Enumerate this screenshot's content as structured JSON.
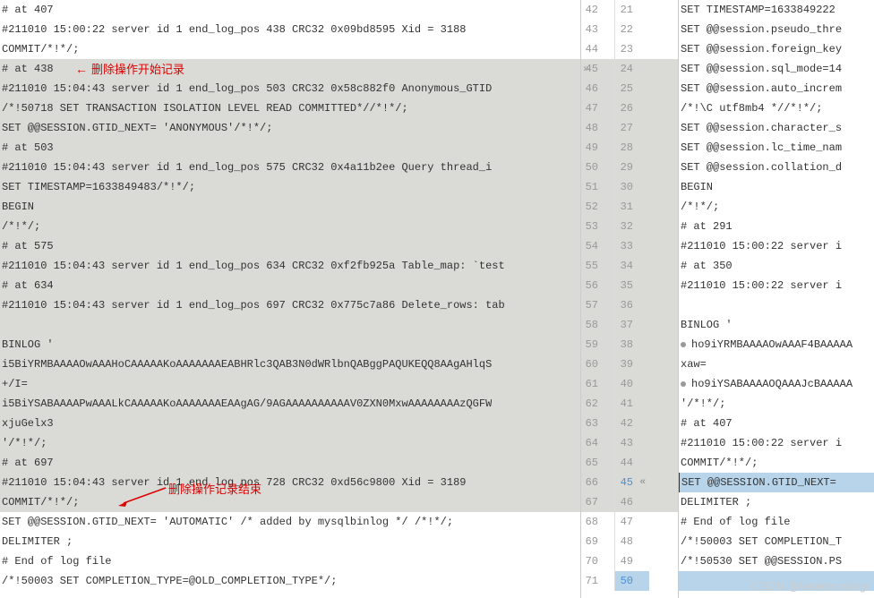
{
  "left_lines": [
    {
      "text": "# at 407",
      "hl": false
    },
    {
      "text": "#211010 15:00:22 server id 1  end_log_pos 438 CRC32 0x09bd8595  Xid = 3188",
      "hl": false
    },
    {
      "text": "COMMIT/*!*/;",
      "hl": false
    },
    {
      "text": "# at 438",
      "hl": true
    },
    {
      "text": "#211010 15:04:43 server id 1  end_log_pos 503 CRC32 0x58c882f0  Anonymous_GTID",
      "hl": true
    },
    {
      "text": "/*!50718 SET TRANSACTION ISOLATION LEVEL READ COMMITTED*//*!*/;",
      "hl": true
    },
    {
      "text": "SET @@SESSION.GTID_NEXT= 'ANONYMOUS'/*!*/;",
      "hl": true
    },
    {
      "text": "# at 503",
      "hl": true
    },
    {
      "text": "#211010 15:04:43 server id 1  end_log_pos 575 CRC32 0x4a11b2ee  Query   thread_i",
      "hl": true
    },
    {
      "text": "SET TIMESTAMP=1633849483/*!*/;",
      "hl": true
    },
    {
      "text": "BEGIN",
      "hl": true
    },
    {
      "text": "/*!*/;",
      "hl": true
    },
    {
      "text": "# at 575",
      "hl": true
    },
    {
      "text": "#211010 15:04:43 server id 1  end_log_pos 634 CRC32 0xf2fb925a  Table_map: `test",
      "hl": true
    },
    {
      "text": "# at 634",
      "hl": true
    },
    {
      "text": "#211010 15:04:43 server id 1  end_log_pos 697 CRC32 0x775c7a86  Delete_rows: tab",
      "hl": true
    },
    {
      "text": "",
      "hl": true
    },
    {
      "text": "BINLOG '",
      "hl": true
    },
    {
      "text": "i5BiYRMBAAAAOwAAAHoCAAAAAKoAAAAAAAEABHRlc3QAB3N0dWRlbnQABggPAQUKEQQ8AAgAHlqS",
      "hl": true
    },
    {
      "text": "+/I=",
      "hl": true
    },
    {
      "text": "i5BiYSABAAAAPwAAALkCAAAAAKoAAAAAAAEAAgAG/9AGAAAAAAAAAAV0ZXN0MxwAAAAAAAAzQGFW",
      "hl": true
    },
    {
      "text": "xjuGelx3",
      "hl": true
    },
    {
      "text": "'/*!*/;",
      "hl": true
    },
    {
      "text": "# at 697",
      "hl": true
    },
    {
      "text": "#211010 15:04:43 server id 1  end_log_pos 728 CRC32 0xd56c9800  Xid = 3189",
      "hl": true
    },
    {
      "text": "COMMIT/*!*/;",
      "hl": true
    },
    {
      "text": "SET @@SESSION.GTID_NEXT= 'AUTOMATIC' /* added by mysqlbinlog */ /*!*/;",
      "hl": false
    },
    {
      "text": "DELIMITER ;",
      "hl": false
    },
    {
      "text": "# End of log file",
      "hl": false
    },
    {
      "text": "/*!50003 SET COMPLETION_TYPE=@OLD_COMPLETION_TYPE*/;",
      "hl": false
    }
  ],
  "gutters": [
    {
      "l": "42",
      "r": "21"
    },
    {
      "l": "43",
      "r": "22"
    },
    {
      "l": "44",
      "r": "23"
    },
    {
      "l": "45",
      "r": "24",
      "hl": "left",
      "diff_marker": "»"
    },
    {
      "l": "46",
      "r": "25",
      "hl": "left"
    },
    {
      "l": "47",
      "r": "26",
      "hl": "left"
    },
    {
      "l": "48",
      "r": "27",
      "hl": "left"
    },
    {
      "l": "49",
      "r": "28",
      "hl": "left"
    },
    {
      "l": "50",
      "r": "29",
      "hl": "left"
    },
    {
      "l": "51",
      "r": "30",
      "hl": "left"
    },
    {
      "l": "52",
      "r": "31",
      "hl": "left"
    },
    {
      "l": "53",
      "r": "32",
      "hl": "left"
    },
    {
      "l": "54",
      "r": "33",
      "hl": "left"
    },
    {
      "l": "55",
      "r": "34",
      "hl": "left"
    },
    {
      "l": "56",
      "r": "35",
      "hl": "left"
    },
    {
      "l": "57",
      "r": "36",
      "hl": "left"
    },
    {
      "l": "58",
      "r": "37",
      "hl": "left"
    },
    {
      "l": "59",
      "r": "38",
      "hl": "left"
    },
    {
      "l": "60",
      "r": "39",
      "hl": "left"
    },
    {
      "l": "61",
      "r": "40",
      "hl": "left"
    },
    {
      "l": "62",
      "r": "41",
      "hl": "left"
    },
    {
      "l": "63",
      "r": "42",
      "hl": "left"
    },
    {
      "l": "64",
      "r": "43",
      "hl": "left"
    },
    {
      "l": "65",
      "r": "44",
      "hl": "left"
    },
    {
      "l": "66",
      "r": "45",
      "hl": "left",
      "diff_marker": "«",
      "blue": true
    },
    {
      "l": "67",
      "r": "46",
      "hl": "left"
    },
    {
      "l": "68",
      "r": "47"
    },
    {
      "l": "69",
      "r": "48"
    },
    {
      "l": "70",
      "r": "49"
    },
    {
      "l": "71",
      "r": "50",
      "hl": "right",
      "blue": true
    }
  ],
  "right_lines": [
    {
      "text": "SET TIMESTAMP=1633849222",
      "hl": false
    },
    {
      "text": "SET @@session.pseudo_thre",
      "hl": false
    },
    {
      "text": "SET @@session.foreign_key",
      "hl": false
    },
    {
      "text": "SET @@session.sql_mode=14",
      "hl": false
    },
    {
      "text": "SET @@session.auto_increm",
      "hl": false
    },
    {
      "text": "/*!\\C utf8mb4 *//*!*/;",
      "hl": false
    },
    {
      "text": "SET @@session.character_s",
      "hl": false
    },
    {
      "text": "SET @@session.lc_time_nam",
      "hl": false
    },
    {
      "text": "SET @@session.collation_d",
      "hl": false
    },
    {
      "text": "BEGIN",
      "hl": false
    },
    {
      "text": "/*!*/;",
      "hl": false
    },
    {
      "text": "# at 291",
      "hl": false
    },
    {
      "text": "#211010 15:00:22 server i",
      "hl": false
    },
    {
      "text": "# at 350",
      "hl": false
    },
    {
      "text": "#211010 15:00:22 server i",
      "hl": false
    },
    {
      "text": "",
      "hl": false
    },
    {
      "text": "BINLOG '",
      "hl": false
    },
    {
      "text": "ho9iYRMBAAAAOwAAAF4BAAAAA",
      "hl": false,
      "dot": true
    },
    {
      "text": "xaw=",
      "hl": false
    },
    {
      "text": "ho9iYSABAAAAOQAAAJcBAAAAA",
      "hl": false,
      "dot": true
    },
    {
      "text": "'/*!*/;",
      "hl": false
    },
    {
      "text": "# at 407",
      "hl": false
    },
    {
      "text": "#211010 15:00:22 server i",
      "hl": false
    },
    {
      "text": "COMMIT/*!*/;",
      "hl": false
    },
    {
      "text": "SET @@SESSION.GTID_NEXT=",
      "hl": "blue",
      "cursor": true
    },
    {
      "text": "DELIMITER ;",
      "hl": false
    },
    {
      "text": "# End of log file",
      "hl": false
    },
    {
      "text": "/*!50003 SET COMPLETION_T",
      "hl": false
    },
    {
      "text": "/*!50530 SET @@SESSION.PS",
      "hl": false
    },
    {
      "text": "",
      "hl": "blue"
    }
  ],
  "annotations": {
    "start": "删除操作开始记录",
    "end": "删除操作记录结束"
  },
  "watermark": "CSDN @liaowenxiong"
}
